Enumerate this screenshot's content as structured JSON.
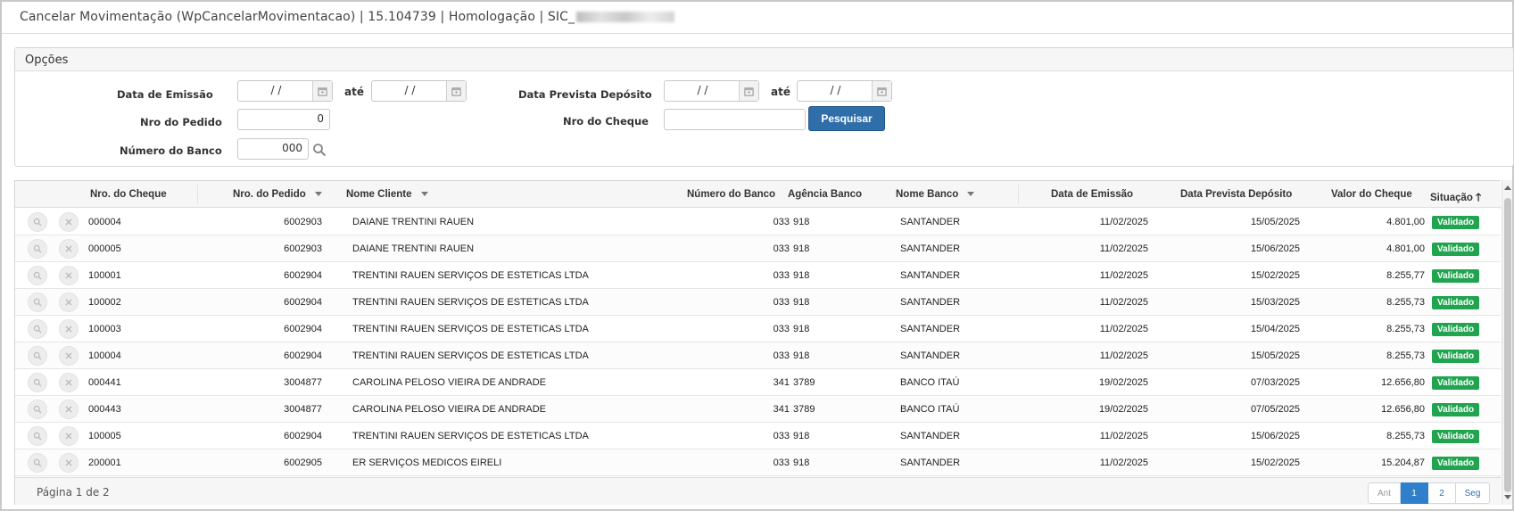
{
  "window": {
    "title": "Cancelar Movimentação (WpCancelarMovimentacao) | 15.104739 | Homologação | SIC_"
  },
  "options": {
    "title": "Opções",
    "data_emissao_label": "Data de Emissão",
    "data_emissao_de": "/ /",
    "data_emissao_ate": "/ /",
    "ate_label": "até",
    "data_prevista_label": "Data Prevista Depósito",
    "data_prevista_de": "/ /",
    "data_prevista_ate": "/ /",
    "nro_pedido_label": "Nro do Pedido",
    "nro_pedido_value": "0",
    "nro_cheque_label": "Nro do Cheque",
    "nro_cheque_value": "",
    "numero_banco_label": "Número do Banco",
    "numero_banco_value": "000",
    "search_button": "Pesquisar"
  },
  "grid": {
    "columns": {
      "nro_cheque": "Nro. do Cheque",
      "nro_pedido": "Nro. do Pedido",
      "nome_cliente": "Nome Cliente",
      "numero_banco": "Número do Banco",
      "agencia_banco": "Agência Banco",
      "nome_banco": "Nome Banco",
      "data_emissao": "Data de Emissão",
      "data_prevista": "Data Prevista Depósito",
      "valor_cheque": "Valor do Cheque",
      "situacao": "Situação"
    },
    "sort_indicator": "🡑",
    "rows": [
      {
        "cheque": "000004",
        "pedido": "6002903",
        "cliente": "DAIANE TRENTINI RAUEN",
        "banco": "033",
        "agencia": "918",
        "nome_banco": "SANTANDER",
        "emissao": "11/02/2025",
        "prevista": "15/05/2025",
        "valor": "4.801,00",
        "situacao": "Validado"
      },
      {
        "cheque": "000005",
        "pedido": "6002903",
        "cliente": "DAIANE TRENTINI RAUEN",
        "banco": "033",
        "agencia": "918",
        "nome_banco": "SANTANDER",
        "emissao": "11/02/2025",
        "prevista": "15/06/2025",
        "valor": "4.801,00",
        "situacao": "Validado"
      },
      {
        "cheque": "100001",
        "pedido": "6002904",
        "cliente": "TRENTINI RAUEN SERVIÇOS DE ESTETICAS LTDA",
        "banco": "033",
        "agencia": "918",
        "nome_banco": "SANTANDER",
        "emissao": "11/02/2025",
        "prevista": "15/02/2025",
        "valor": "8.255,77",
        "situacao": "Validado"
      },
      {
        "cheque": "100002",
        "pedido": "6002904",
        "cliente": "TRENTINI RAUEN SERVIÇOS DE ESTETICAS LTDA",
        "banco": "033",
        "agencia": "918",
        "nome_banco": "SANTANDER",
        "emissao": "11/02/2025",
        "prevista": "15/03/2025",
        "valor": "8.255,73",
        "situacao": "Validado"
      },
      {
        "cheque": "100003",
        "pedido": "6002904",
        "cliente": "TRENTINI RAUEN SERVIÇOS DE ESTETICAS LTDA",
        "banco": "033",
        "agencia": "918",
        "nome_banco": "SANTANDER",
        "emissao": "11/02/2025",
        "prevista": "15/04/2025",
        "valor": "8.255,73",
        "situacao": "Validado"
      },
      {
        "cheque": "100004",
        "pedido": "6002904",
        "cliente": "TRENTINI RAUEN SERVIÇOS DE ESTETICAS LTDA",
        "banco": "033",
        "agencia": "918",
        "nome_banco": "SANTANDER",
        "emissao": "11/02/2025",
        "prevista": "15/05/2025",
        "valor": "8.255,73",
        "situacao": "Validado"
      },
      {
        "cheque": "000441",
        "pedido": "3004877",
        "cliente": "CAROLINA PELOSO VIEIRA DE ANDRADE",
        "banco": "341",
        "agencia": "3789",
        "nome_banco": "BANCO ITAÚ",
        "emissao": "19/02/2025",
        "prevista": "07/03/2025",
        "valor": "12.656,80",
        "situacao": "Validado"
      },
      {
        "cheque": "000443",
        "pedido": "3004877",
        "cliente": "CAROLINA PELOSO VIEIRA DE ANDRADE",
        "banco": "341",
        "agencia": "3789",
        "nome_banco": "BANCO ITAÚ",
        "emissao": "19/02/2025",
        "prevista": "07/05/2025",
        "valor": "12.656,80",
        "situacao": "Validado"
      },
      {
        "cheque": "100005",
        "pedido": "6002904",
        "cliente": "TRENTINI RAUEN SERVIÇOS DE ESTETICAS LTDA",
        "banco": "033",
        "agencia": "918",
        "nome_banco": "SANTANDER",
        "emissao": "11/02/2025",
        "prevista": "15/06/2025",
        "valor": "8.255,73",
        "situacao": "Validado"
      },
      {
        "cheque": "200001",
        "pedido": "6002905",
        "cliente": "ER SERVIÇOS MEDICOS EIRELI",
        "banco": "033",
        "agencia": "918",
        "nome_banco": "SANTANDER",
        "emissao": "11/02/2025",
        "prevista": "15/02/2025",
        "valor": "15.204,87",
        "situacao": "Validado"
      }
    ]
  },
  "pagination": {
    "info": "Página 1 de 2",
    "prev": "Ant",
    "pages": [
      "1",
      "2"
    ],
    "next": "Seg",
    "current": "1"
  },
  "colors": {
    "primary": "#2f6ea9",
    "badge_success": "#21a44f",
    "active_page": "#2f7fca"
  }
}
